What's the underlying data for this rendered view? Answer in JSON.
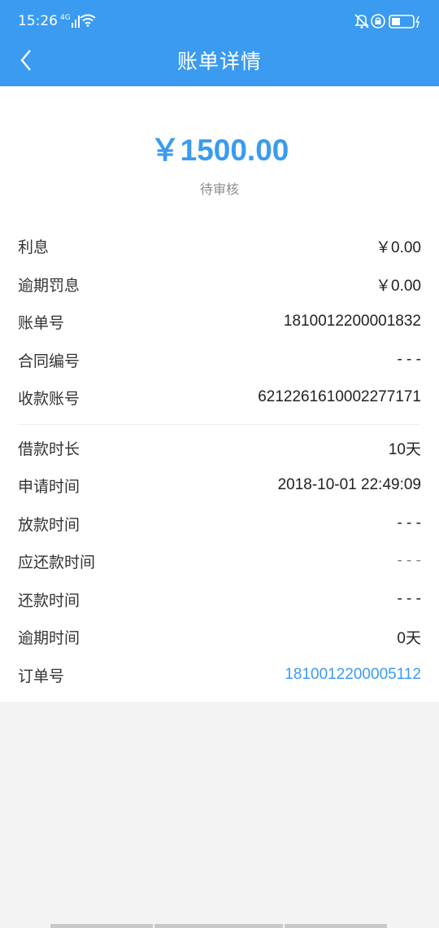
{
  "status_bar": {
    "time": "15:26",
    "network": "4G",
    "icons": [
      "signal-icon",
      "wifi-icon",
      "alarm-icon",
      "lock-rotation-icon",
      "battery-icon"
    ]
  },
  "header": {
    "title": "账单详情",
    "back_icon": "chevron-left-icon"
  },
  "summary": {
    "amount": "￥1500.00",
    "status": "待审核"
  },
  "details": {
    "interest": {
      "label": "利息",
      "value": "￥0.00"
    },
    "penalty": {
      "label": "逾期罚息",
      "value": "￥0.00"
    },
    "bill_no": {
      "label": "账单号",
      "value": "1810012200001832"
    },
    "contract_no": {
      "label": "合同编号",
      "value": "- - -"
    },
    "account_no": {
      "label": "收款账号",
      "value": "6212261610002277171"
    },
    "duration": {
      "label": "借款时长",
      "value": "10天"
    },
    "apply_time": {
      "label": "申请时间",
      "value": "2018-10-01 22:49:09"
    },
    "disburse_time": {
      "label": "放款时间",
      "value": "- - -"
    },
    "due_time": {
      "label": "应还款时间",
      "value": "- - -"
    },
    "repay_time": {
      "label": "还款时间",
      "value": "- - -"
    },
    "overdue_time": {
      "label": "逾期时间",
      "value": "0天"
    },
    "order_no": {
      "label": "订单号",
      "value": "1810012200005112"
    }
  },
  "colors": {
    "primary": "#3a9bf0",
    "background": "#f3f3f3"
  }
}
